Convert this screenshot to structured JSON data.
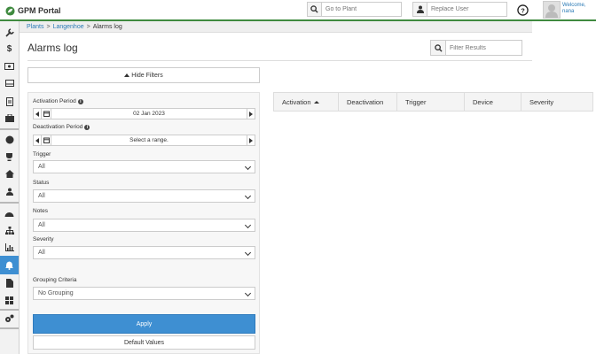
{
  "app": {
    "title": "GPM Portal",
    "brand_color": "#3f8a3f",
    "accent": "#3e8fd2"
  },
  "topbar": {
    "plant_search_placeholder": "Go to Plant",
    "user_search_placeholder": "Replace User",
    "welcome": "Welcome,",
    "username": "nana"
  },
  "sidebar": {
    "items": [
      "wrench-icon",
      "dollar-icon",
      "tickets-icon",
      "inbox-icon",
      "report-icon",
      "briefcase-icon",
      "globe-icon",
      "trophy-icon",
      "home-icon",
      "user-icon",
      "dashboard-icon",
      "sitemap-icon",
      "bar-chart-icon",
      "bell-icon",
      "document-icon",
      "grid-icon",
      "cogs-icon"
    ],
    "active": "bell-icon"
  },
  "breadcrumb": {
    "items": [
      "Plants",
      "Langenhoe"
    ],
    "current": "Alarms log"
  },
  "page": {
    "title": "Alarms log",
    "filter_placeholder": "Filter Results",
    "hide_filters": "Hide Filters"
  },
  "filters": {
    "activation_label": "Activation Period",
    "activation_value": "02 Jan 2023",
    "deactivation_label": "Deactivation Period",
    "deactivation_value": "Select a range.",
    "trigger_label": "Trigger",
    "trigger_value": "All",
    "status_label": "Status",
    "status_value": "All",
    "notes_label": "Notes",
    "notes_value": "All",
    "severity_label": "Severity",
    "severity_value": "All",
    "grouping_label": "Grouping Criteria",
    "grouping_value": "No Grouping",
    "apply": "Apply",
    "defaults": "Default Values"
  },
  "table": {
    "columns": [
      "Activation",
      "Deactivation",
      "Trigger",
      "Device",
      "Severity"
    ]
  }
}
